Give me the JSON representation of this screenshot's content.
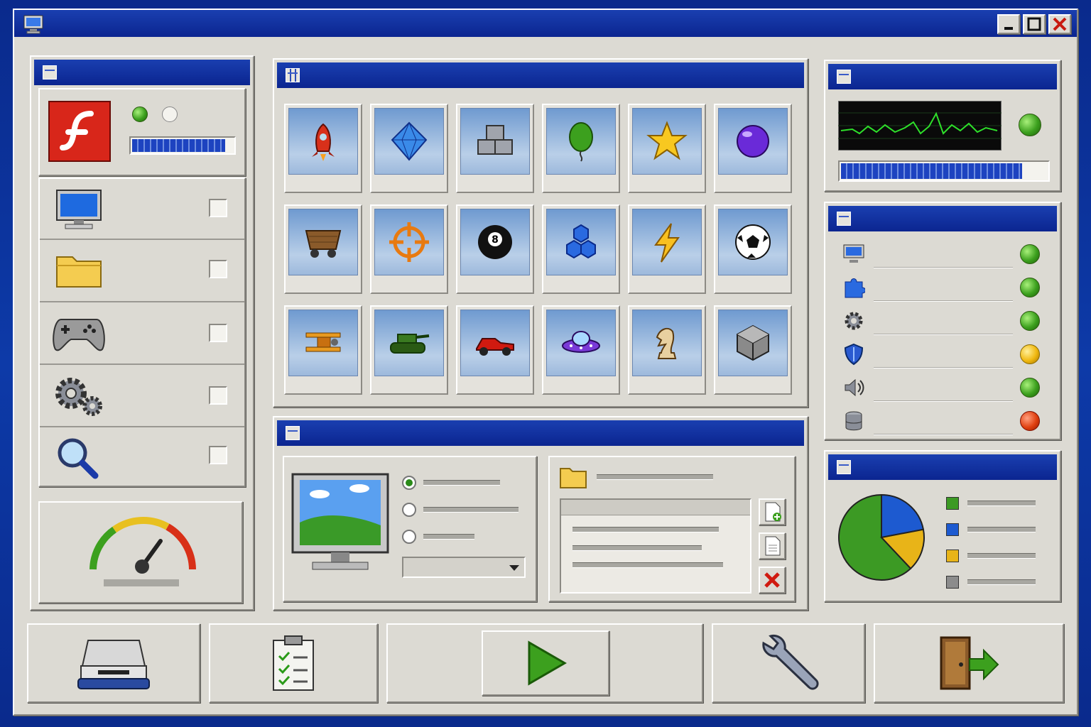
{
  "window": {
    "title_icon": "computer-icon",
    "controls": [
      "minimize-icon",
      "maximize-icon",
      "close-icon"
    ]
  },
  "left_panel": {
    "flash": {
      "icon": "flash-player-icon",
      "progress": 0.92,
      "leds": [
        "on",
        "off"
      ]
    },
    "items": [
      {
        "name": "monitor",
        "icon": "monitor-icon",
        "checked": false
      },
      {
        "name": "folder",
        "icon": "folder-icon",
        "checked": false
      },
      {
        "name": "gamepad",
        "icon": "gamepad-icon",
        "checked": false
      },
      {
        "name": "settings",
        "icon": "gears-icon",
        "checked": false
      },
      {
        "name": "search",
        "icon": "magnifier-icon",
        "checked": false
      }
    ],
    "gauge": {
      "icon": "speedometer-icon",
      "level": 0.7
    }
  },
  "games_grid": {
    "tiles": [
      "rocket",
      "diamond",
      "blocks",
      "balloon",
      "star",
      "orb",
      "mine-cart",
      "crosshair",
      "eight-ball",
      "hexagons",
      "lightning",
      "soccer-ball",
      "biplane",
      "tank",
      "race-car",
      "ufo",
      "chess-knight",
      "cube"
    ]
  },
  "display_panel": {
    "radio_options": [
      {
        "selected": true
      },
      {
        "selected": false
      },
      {
        "selected": false
      }
    ],
    "file_actions": [
      "new-file-icon",
      "document-icon",
      "delete-icon"
    ]
  },
  "monitor_panel": {
    "progress": 0.88,
    "status_led": "green"
  },
  "status_panel": {
    "rows": [
      {
        "icon": "monitor-icon",
        "status": "green"
      },
      {
        "icon": "puzzle-icon",
        "status": "green"
      },
      {
        "icon": "gear-icon",
        "status": "green"
      },
      {
        "icon": "shield-icon",
        "status": "yellow"
      },
      {
        "icon": "speaker-icon",
        "status": "green"
      },
      {
        "icon": "database-icon",
        "status": "red"
      }
    ]
  },
  "pie_panel": {
    "legend_colors": [
      "#3c9a24",
      "#1d5ad0",
      "#e8b418",
      "#8c8c8c"
    ],
    "slices": [
      0.62,
      0.22,
      0.16
    ]
  },
  "bottom_bar": {
    "buttons": [
      "drive-icon",
      "clipboard-icon",
      "play-icon",
      "wrench-icon",
      "exit-icon"
    ]
  },
  "colors": {
    "accent": "#0b2590",
    "face": "#dcdad3"
  }
}
